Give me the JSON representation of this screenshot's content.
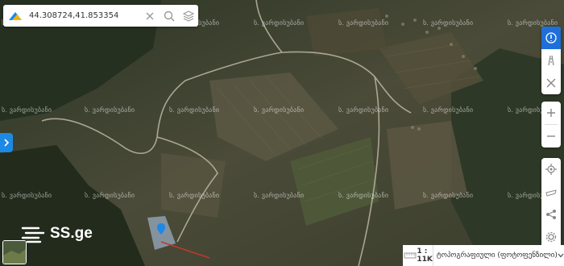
{
  "search": {
    "coordinates": "44.308724,41.853354"
  },
  "map": {
    "watermark": "ს. ვარდისუბანი",
    "marker_color": "#1e88e5"
  },
  "brand": {
    "name": "SS.ge"
  },
  "toolbar": {
    "accent": "#1e6fd9"
  },
  "bottom_bar": {
    "scale": "1 : 11K",
    "layer": "ტოპოგრაფიული (ფოტოფენზილი)"
  },
  "icons": [
    "logo-icon",
    "close-icon",
    "search-icon",
    "layers-icon",
    "chevron-right-icon",
    "info-icon",
    "road-icon",
    "tools-icon",
    "zoom-in-icon",
    "zoom-out-icon",
    "locate-icon",
    "measure-icon",
    "share-icon",
    "settings-icon",
    "ruler-icon",
    "chevron-down-icon",
    "map-pin-icon"
  ]
}
